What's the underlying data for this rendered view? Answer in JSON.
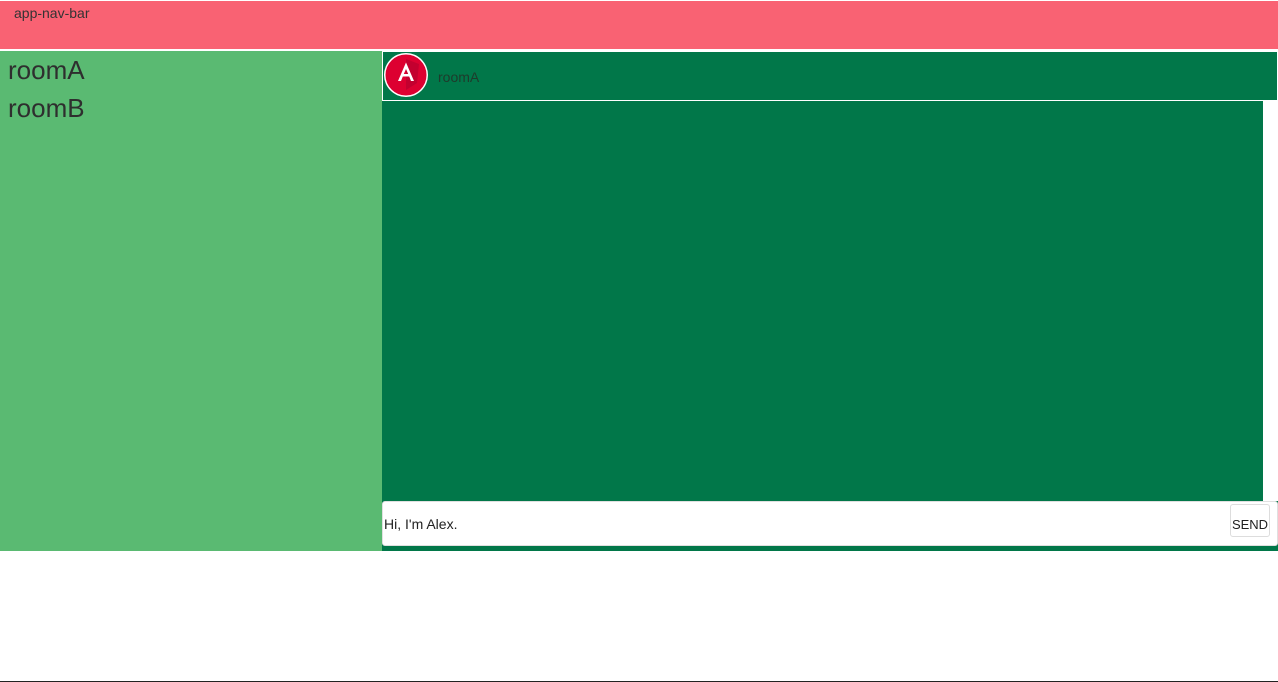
{
  "navbar": {
    "title": "app-nav-bar",
    "color": "#f96273"
  },
  "sidebar": {
    "color": "#5aba72",
    "rooms": [
      {
        "label": "roomA"
      },
      {
        "label": "roomB"
      }
    ]
  },
  "chat": {
    "color": "#017749",
    "header": {
      "avatar_icon": "angular-logo-icon",
      "title": "roomA"
    },
    "composer": {
      "input_value": "Hi, I'm Alex.",
      "send_label": "SEND"
    }
  }
}
